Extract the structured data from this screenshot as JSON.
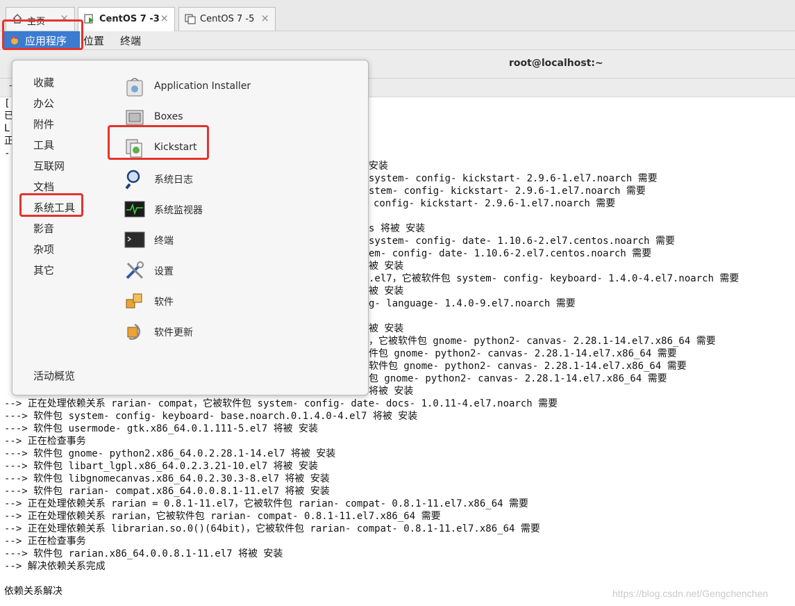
{
  "tabs": [
    {
      "label": "主页"
    },
    {
      "label": "CentOS 7 -3"
    },
    {
      "label": "CentOS 7 -5"
    }
  ],
  "panel": {
    "app_menu": "应用程序",
    "places": "位置",
    "terminal": "终端"
  },
  "window_title": "root@localhost:~",
  "app_popup": {
    "categories": [
      "收藏",
      "办公",
      "附件",
      "工具",
      "互联网",
      "文档",
      "系统工具",
      "影音",
      "杂项",
      "其它"
    ],
    "overview": "活动概览",
    "apps": [
      {
        "label": "Application Installer",
        "icon": "installer-icon"
      },
      {
        "label": "Boxes",
        "icon": "boxes-icon"
      },
      {
        "label": "Kickstart",
        "icon": "kickstart-icon"
      },
      {
        "label": "系统日志",
        "icon": "log-search-icon"
      },
      {
        "label": "系统监视器",
        "icon": "monitor-icon"
      },
      {
        "label": "终端",
        "icon": "terminal-icon"
      },
      {
        "label": "设置",
        "icon": "tools-icon"
      },
      {
        "label": "软件",
        "icon": "software-icon"
      },
      {
        "label": "软件更新",
        "icon": "update-icon"
      }
    ]
  },
  "terminal_partial": [
    "[",
    "已",
    "L",
    "正",
    "安装",
    "system- config- kickstart- 2.9.6-1.el7.noarch 需要",
    "stem- config- kickstart- 2.9.6-1.el7.noarch 需要",
    "config- kickstart- 2.9.6-1.el7.noarch 需要",
    "s 将被 安装",
    "system- config- date- 1.10.6-2.el7.centos.noarch 需要",
    "em- config- date- 1.10.6-2.el7.centos.noarch 需要",
    "被 安装",
    ".el7，它被软件包 system- config- keyboard- 1.4.0-4.el7.noarch 需要",
    "被 安装",
    "g- language- 1.4.0-9.el7.noarch 需要",
    "被 安装",
    "，它被软件包 gnome- python2- canvas- 2.28.1-14.el7.x86_64 需要",
    "件包 gnome- python2- canvas- 2.28.1-14.el7.x86_64 需要",
    "软件包 gnome- python2- canvas- 2.28.1-14.el7.x86_64 需要",
    "包 gnome- python2- canvas- 2.28.1-14.el7.x86_64 需要",
    "将被 安装"
  ],
  "terminal_lines": [
    "--> 正在处理依赖关系 rarian- compat，它被软件包 system- config- date- docs- 1.0.11-4.el7.noarch 需要",
    "---> 软件包 system- config- keyboard- base.noarch.0.1.4.0-4.el7 将被 安装",
    "---> 软件包 usermode- gtk.x86_64.0.1.111-5.el7 将被 安装",
    "--> 正在检查事务",
    "---> 软件包 gnome- python2.x86_64.0.2.28.1-14.el7 将被 安装",
    "---> 软件包 libart_lgpl.x86_64.0.2.3.21-10.el7 将被 安装",
    "---> 软件包 libgnomecanvas.x86_64.0.2.30.3-8.el7 将被 安装",
    "---> 软件包 rarian- compat.x86_64.0.0.8.1-11.el7 将被 安装",
    "--> 正在处理依赖关系 rarian = 0.8.1-11.el7，它被软件包 rarian- compat- 0.8.1-11.el7.x86_64 需要",
    "--> 正在处理依赖关系 rarian，它被软件包 rarian- compat- 0.8.1-11.el7.x86_64 需要",
    "--> 正在处理依赖关系 librarian.so.0()(64bit)，它被软件包 rarian- compat- 0.8.1-11.el7.x86_64 需要",
    "--> 正在检查事务",
    "---> 软件包 rarian.x86_64.0.0.8.1-11.el7 将被 安装",
    "--> 解决依赖关系完成",
    "",
    "依赖关系解决"
  ],
  "watermark": "https://blog.csdn.net/Gengchenchen",
  "colors": {
    "highlight": "#e5322d",
    "menu_active": "#3b7bd0"
  }
}
